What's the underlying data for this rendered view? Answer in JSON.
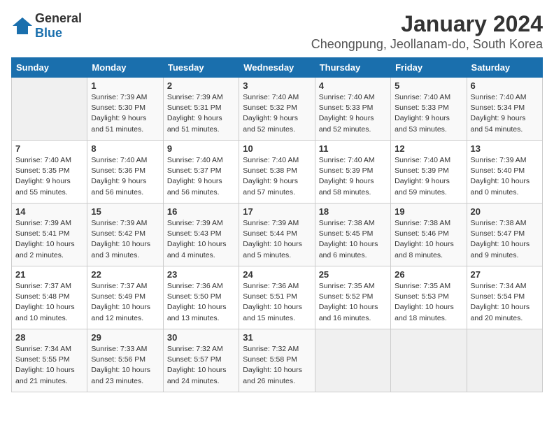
{
  "logo": {
    "general": "General",
    "blue": "Blue"
  },
  "title": "January 2024",
  "subtitle": "Cheongpung, Jeollanam-do, South Korea",
  "days_of_week": [
    "Sunday",
    "Monday",
    "Tuesday",
    "Wednesday",
    "Thursday",
    "Friday",
    "Saturday"
  ],
  "weeks": [
    [
      {
        "num": "",
        "info": ""
      },
      {
        "num": "1",
        "info": "Sunrise: 7:39 AM\nSunset: 5:30 PM\nDaylight: 9 hours\nand 51 minutes."
      },
      {
        "num": "2",
        "info": "Sunrise: 7:39 AM\nSunset: 5:31 PM\nDaylight: 9 hours\nand 51 minutes."
      },
      {
        "num": "3",
        "info": "Sunrise: 7:40 AM\nSunset: 5:32 PM\nDaylight: 9 hours\nand 52 minutes."
      },
      {
        "num": "4",
        "info": "Sunrise: 7:40 AM\nSunset: 5:33 PM\nDaylight: 9 hours\nand 52 minutes."
      },
      {
        "num": "5",
        "info": "Sunrise: 7:40 AM\nSunset: 5:33 PM\nDaylight: 9 hours\nand 53 minutes."
      },
      {
        "num": "6",
        "info": "Sunrise: 7:40 AM\nSunset: 5:34 PM\nDaylight: 9 hours\nand 54 minutes."
      }
    ],
    [
      {
        "num": "7",
        "info": "Sunrise: 7:40 AM\nSunset: 5:35 PM\nDaylight: 9 hours\nand 55 minutes."
      },
      {
        "num": "8",
        "info": "Sunrise: 7:40 AM\nSunset: 5:36 PM\nDaylight: 9 hours\nand 56 minutes."
      },
      {
        "num": "9",
        "info": "Sunrise: 7:40 AM\nSunset: 5:37 PM\nDaylight: 9 hours\nand 56 minutes."
      },
      {
        "num": "10",
        "info": "Sunrise: 7:40 AM\nSunset: 5:38 PM\nDaylight: 9 hours\nand 57 minutes."
      },
      {
        "num": "11",
        "info": "Sunrise: 7:40 AM\nSunset: 5:39 PM\nDaylight: 9 hours\nand 58 minutes."
      },
      {
        "num": "12",
        "info": "Sunrise: 7:40 AM\nSunset: 5:39 PM\nDaylight: 9 hours\nand 59 minutes."
      },
      {
        "num": "13",
        "info": "Sunrise: 7:39 AM\nSunset: 5:40 PM\nDaylight: 10 hours\nand 0 minutes."
      }
    ],
    [
      {
        "num": "14",
        "info": "Sunrise: 7:39 AM\nSunset: 5:41 PM\nDaylight: 10 hours\nand 2 minutes."
      },
      {
        "num": "15",
        "info": "Sunrise: 7:39 AM\nSunset: 5:42 PM\nDaylight: 10 hours\nand 3 minutes."
      },
      {
        "num": "16",
        "info": "Sunrise: 7:39 AM\nSunset: 5:43 PM\nDaylight: 10 hours\nand 4 minutes."
      },
      {
        "num": "17",
        "info": "Sunrise: 7:39 AM\nSunset: 5:44 PM\nDaylight: 10 hours\nand 5 minutes."
      },
      {
        "num": "18",
        "info": "Sunrise: 7:38 AM\nSunset: 5:45 PM\nDaylight: 10 hours\nand 6 minutes."
      },
      {
        "num": "19",
        "info": "Sunrise: 7:38 AM\nSunset: 5:46 PM\nDaylight: 10 hours\nand 8 minutes."
      },
      {
        "num": "20",
        "info": "Sunrise: 7:38 AM\nSunset: 5:47 PM\nDaylight: 10 hours\nand 9 minutes."
      }
    ],
    [
      {
        "num": "21",
        "info": "Sunrise: 7:37 AM\nSunset: 5:48 PM\nDaylight: 10 hours\nand 10 minutes."
      },
      {
        "num": "22",
        "info": "Sunrise: 7:37 AM\nSunset: 5:49 PM\nDaylight: 10 hours\nand 12 minutes."
      },
      {
        "num": "23",
        "info": "Sunrise: 7:36 AM\nSunset: 5:50 PM\nDaylight: 10 hours\nand 13 minutes."
      },
      {
        "num": "24",
        "info": "Sunrise: 7:36 AM\nSunset: 5:51 PM\nDaylight: 10 hours\nand 15 minutes."
      },
      {
        "num": "25",
        "info": "Sunrise: 7:35 AM\nSunset: 5:52 PM\nDaylight: 10 hours\nand 16 minutes."
      },
      {
        "num": "26",
        "info": "Sunrise: 7:35 AM\nSunset: 5:53 PM\nDaylight: 10 hours\nand 18 minutes."
      },
      {
        "num": "27",
        "info": "Sunrise: 7:34 AM\nSunset: 5:54 PM\nDaylight: 10 hours\nand 20 minutes."
      }
    ],
    [
      {
        "num": "28",
        "info": "Sunrise: 7:34 AM\nSunset: 5:55 PM\nDaylight: 10 hours\nand 21 minutes."
      },
      {
        "num": "29",
        "info": "Sunrise: 7:33 AM\nSunset: 5:56 PM\nDaylight: 10 hours\nand 23 minutes."
      },
      {
        "num": "30",
        "info": "Sunrise: 7:32 AM\nSunset: 5:57 PM\nDaylight: 10 hours\nand 24 minutes."
      },
      {
        "num": "31",
        "info": "Sunrise: 7:32 AM\nSunset: 5:58 PM\nDaylight: 10 hours\nand 26 minutes."
      },
      {
        "num": "",
        "info": ""
      },
      {
        "num": "",
        "info": ""
      },
      {
        "num": "",
        "info": ""
      }
    ]
  ]
}
